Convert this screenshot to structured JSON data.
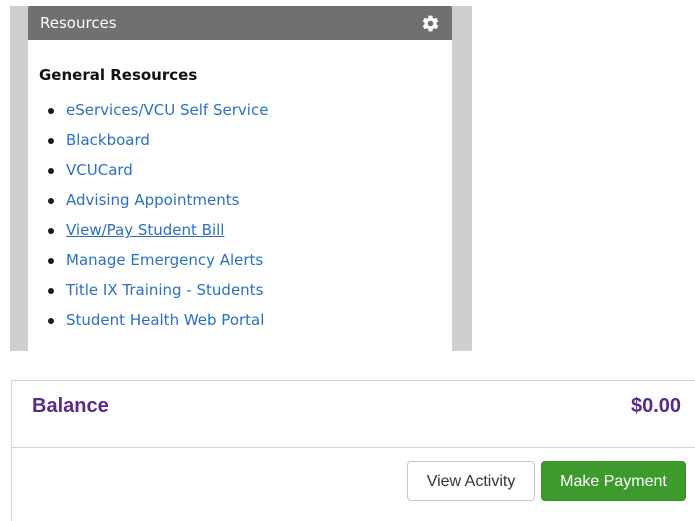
{
  "resources": {
    "title": "Resources",
    "subheading": "General Resources",
    "links": [
      {
        "label": "eServices/VCU Self Service"
      },
      {
        "label": "Blackboard"
      },
      {
        "label": "VCUCard"
      },
      {
        "label": "Advising Appointments"
      },
      {
        "label": "View/Pay Student Bill"
      },
      {
        "label": "Manage Emergency Alerts"
      },
      {
        "label": "Title IX Training - Students"
      },
      {
        "label": "Student Health Web Portal"
      }
    ],
    "gear_icon": "gear-icon"
  },
  "balance": {
    "label": "Balance",
    "amount": "$0.00",
    "view_activity_label": "View Activity",
    "make_payment_label": "Make Payment"
  },
  "colors": {
    "link": "#2a6fc6",
    "balance_text": "#5a2a87",
    "pay_button": "#3f9a2e",
    "header_bar": "#707070"
  }
}
